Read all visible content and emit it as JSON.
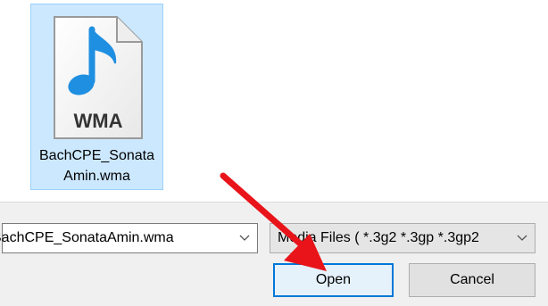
{
  "file_list": {
    "items": [
      {
        "name": "BachCPE_Sonata\nAmin.wma",
        "icon": "wma-audio-file-icon",
        "icon_label": "WMA",
        "selected": true
      }
    ]
  },
  "footer": {
    "filename_value": "BachCPE_SonataAmin.wma",
    "file_type_filter": "Media Files ( *.3g2 *.3gp *.3gp2",
    "open_label": "Open",
    "cancel_label": "Cancel"
  },
  "colors": {
    "selection_fill": "#cce8ff",
    "selection_border": "#99d1ff",
    "default_button_border": "#0078d7",
    "annotation_arrow": "#e8141a",
    "note_icon_blue": "#1e8fe1"
  }
}
